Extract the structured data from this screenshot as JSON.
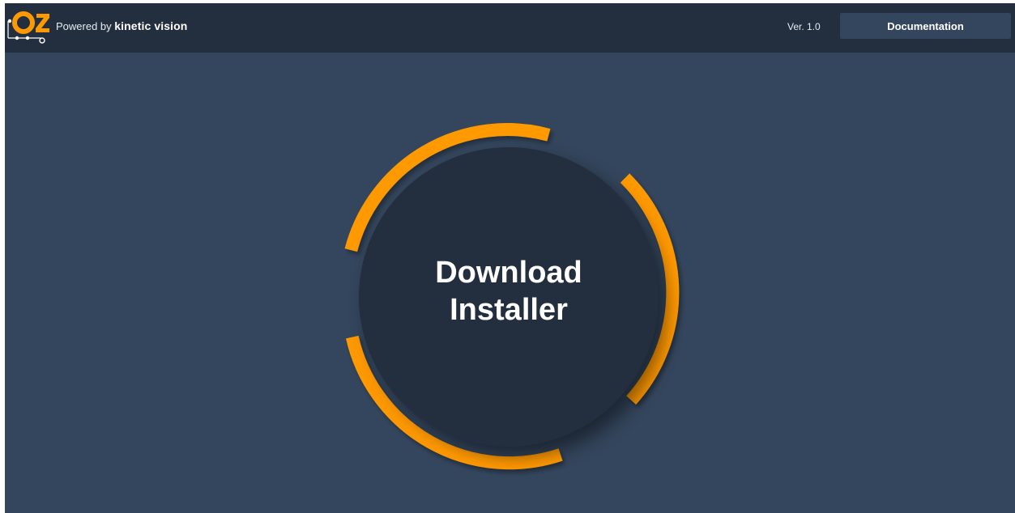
{
  "header": {
    "powered_prefix": "Powered by",
    "brand_name": "kinetic vision",
    "version": "Ver. 1.0",
    "documentation_label": "Documentation"
  },
  "logo": {
    "icon": "oz-logo-icon",
    "text": "OZ"
  },
  "main": {
    "download_line1": "Download",
    "download_line2": "Installer"
  },
  "colors": {
    "page_bg": "#34465d",
    "header_bg": "#232f3f",
    "button_bg": "#232e3e",
    "accent": "#ff9900"
  }
}
